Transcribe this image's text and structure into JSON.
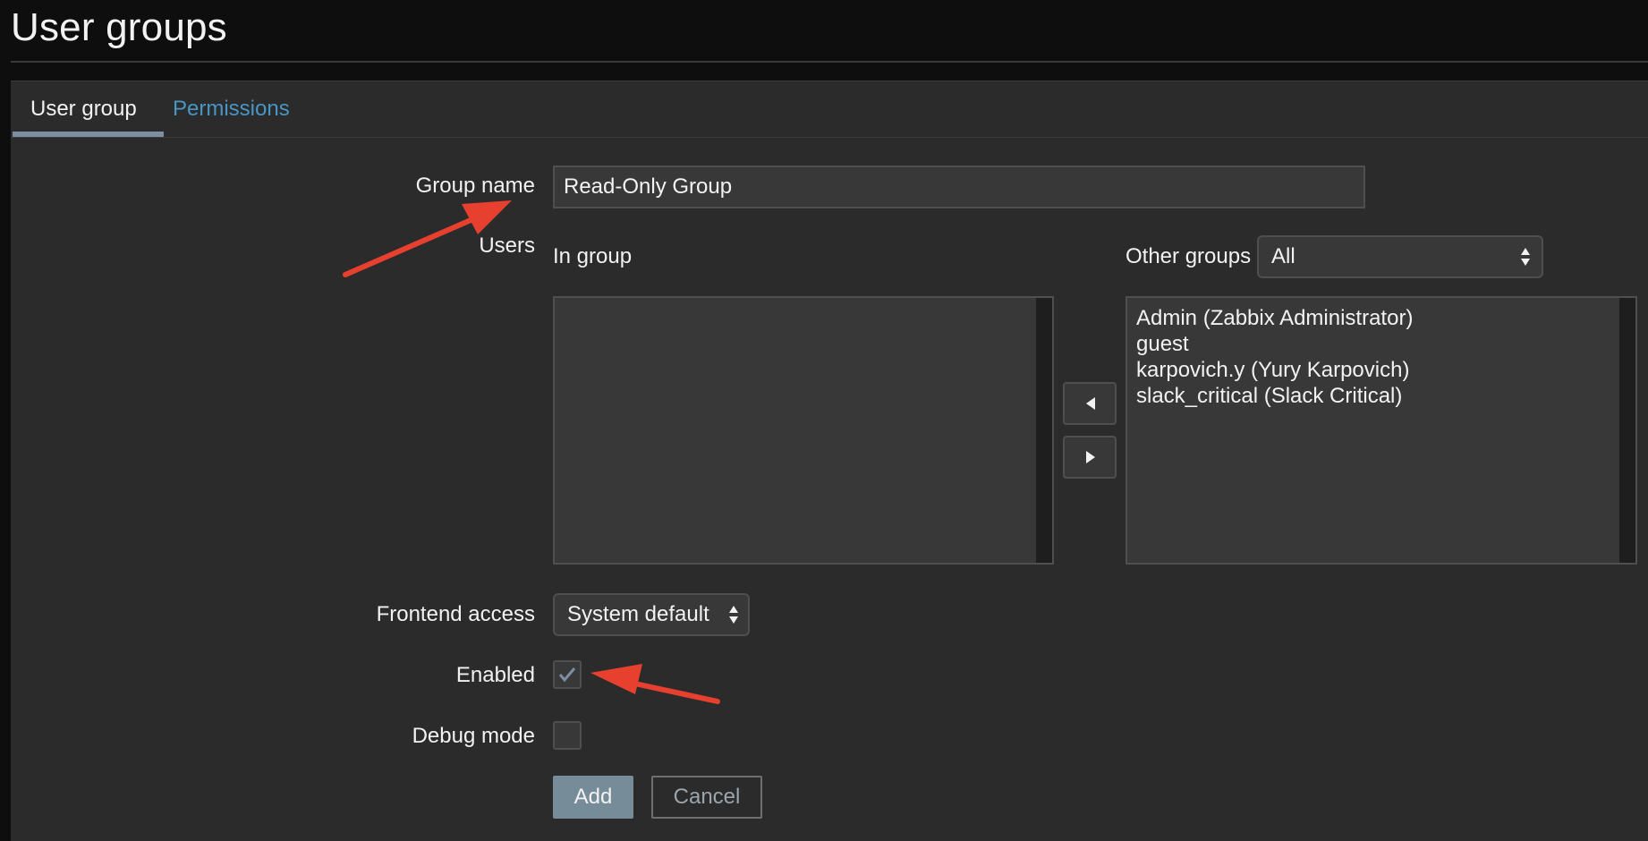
{
  "header": {
    "title": "User groups"
  },
  "tabs": [
    {
      "label": "User group",
      "active": true
    },
    {
      "label": "Permissions",
      "active": false
    }
  ],
  "form": {
    "group_name": {
      "label": "Group name",
      "value": "Read-Only Group"
    },
    "users": {
      "label": "Users",
      "in_group_label": "In group",
      "in_group_items": [],
      "other_groups_label": "Other groups",
      "other_groups_selected": "All",
      "other_items": [
        "Admin (Zabbix Administrator)",
        "guest",
        "karpovich.y (Yury Karpovich)",
        "slack_critical (Slack Critical)"
      ]
    },
    "frontend_access": {
      "label": "Frontend access",
      "value": "System default"
    },
    "enabled": {
      "label": "Enabled",
      "checked": true
    },
    "debug_mode": {
      "label": "Debug mode",
      "checked": false
    },
    "buttons": {
      "add": "Add",
      "cancel": "Cancel"
    }
  },
  "colors": {
    "background": "#2b2b2b",
    "header_background": "#0e0e0e",
    "link": "#4796c4",
    "add_button": "#768d99",
    "annotation_arrow": "#e8402e"
  }
}
